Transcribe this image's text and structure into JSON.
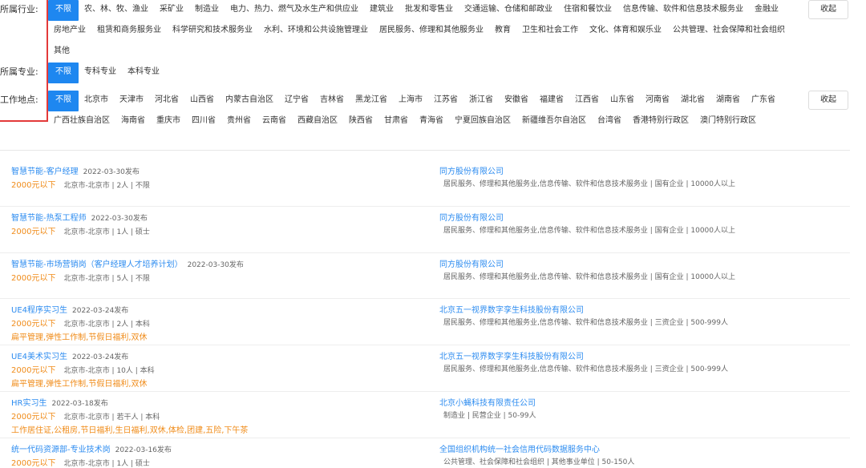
{
  "filters": {
    "industry": {
      "label": "所属行业:",
      "options": [
        "不限",
        "农、林、牧、渔业",
        "采矿业",
        "制造业",
        "电力、热力、燃气及水生产和供应业",
        "建筑业",
        "批发和零售业",
        "交通运输、仓储和邮政业",
        "住宿和餐饮业",
        "信息传输、软件和信息技术服务业",
        "金融业",
        "房地产业",
        "租赁和商务服务业",
        "科学研究和技术服务业",
        "水利、环境和公共设施管理业",
        "居民服务、修理和其他服务业",
        "教育",
        "卫生和社会工作",
        "文化、体育和娱乐业",
        "公共管理、社会保障和社会组织",
        "其他"
      ],
      "collapse_label": "收起"
    },
    "major": {
      "label": "所属专业:",
      "options": [
        "不限",
        "专科专业",
        "本科专业"
      ]
    },
    "location": {
      "label": "工作地点:",
      "options": [
        "不限",
        "北京市",
        "天津市",
        "河北省",
        "山西省",
        "内蒙古自治区",
        "辽宁省",
        "吉林省",
        "黑龙江省",
        "上海市",
        "江苏省",
        "浙江省",
        "安徽省",
        "福建省",
        "江西省",
        "山东省",
        "河南省",
        "湖北省",
        "湖南省",
        "广东省",
        "广西壮族自治区",
        "海南省",
        "重庆市",
        "四川省",
        "贵州省",
        "云南省",
        "西藏自治区",
        "陕西省",
        "甘肃省",
        "青海省",
        "宁夏回族自治区",
        "新疆维吾尔自治区",
        "台湾省",
        "香港特别行政区",
        "澳门特别行政区"
      ],
      "collapse_label": "收起"
    }
  },
  "jobs": [
    {
      "title": "智慧节能-客户经理",
      "date": "2022-03-30发布",
      "salary": "2000元以下",
      "meta": "北京市-北京市 |  2人 | 不限",
      "benefits": "",
      "company": "同方股份有限公司",
      "company_meta": "居民服务、修理和其他服务业,信息传输、软件和信息技术服务业 |  国有企业 |    10000人以上"
    },
    {
      "title": "智慧节能-热泵工程师",
      "date": "2022-03-30发布",
      "salary": "2000元以下",
      "meta": "北京市-北京市 |  1人 | 硕士",
      "benefits": "",
      "company": "同方股份有限公司",
      "company_meta": "居民服务、修理和其他服务业,信息传输、软件和信息技术服务业 |  国有企业 |    10000人以上"
    },
    {
      "title": "智慧节能-市场营销岗（客户经理人才培养计划）",
      "date": "2022-03-30发布",
      "salary": "2000元以下",
      "meta": "北京市-北京市 |  5人 | 不限",
      "benefits": "",
      "company": "同方股份有限公司",
      "company_meta": "居民服务、修理和其他服务业,信息传输、软件和信息技术服务业 |  国有企业 |    10000人以上"
    },
    {
      "title": "UE4程序实习生",
      "date": "2022-03-24发布",
      "salary": "2000元以下",
      "meta": "北京市-北京市 |  2人 | 本科",
      "benefits": "扁平管理,弹性工作制,节假日福利,双休",
      "company": "北京五一视界数字孪生科技股份有限公司",
      "company_meta": "居民服务、修理和其他服务业,信息传输、软件和信息技术服务业 |  三资企业 |    500-999人"
    },
    {
      "title": "UE4美术实习生",
      "date": "2022-03-24发布",
      "salary": "2000元以下",
      "meta": "北京市-北京市 |  10人 | 本科",
      "benefits": "扁平管理,弹性工作制,节假日福利,双休",
      "company": "北京五一视界数字孪生科技股份有限公司",
      "company_meta": "居民服务、修理和其他服务业,信息传输、软件和信息技术服务业 |  三资企业 |    500-999人"
    },
    {
      "title": "HR实习生",
      "date": "2022-03-18发布",
      "salary": "2000元以下",
      "meta": "北京市-北京市 |  若干人 | 本科",
      "benefits": "工作居住证,公租房,节日福利,生日福利,双休,体检,团建,五险,下午茶",
      "company": "北京小蝇科技有限责任公司",
      "company_meta": "制造业 |  民营企业 |    50-99人"
    },
    {
      "title": "统一代码资源部-专业技术岗",
      "date": "2022-03-16发布",
      "salary": "2000元以下",
      "meta": "北京市-北京市 |  1人 | 硕士",
      "benefits": "",
      "company": "全国组织机构统一社会信用代码数据服务中心",
      "company_meta": "公共管理、社会保障和社会组织 |  其他事业单位 |    50-150人"
    }
  ],
  "colors": {
    "accent": "#1e87f0",
    "link": "#2d8cf0",
    "salary": "#f08c1a",
    "highlight_box": "#e33a3a"
  }
}
